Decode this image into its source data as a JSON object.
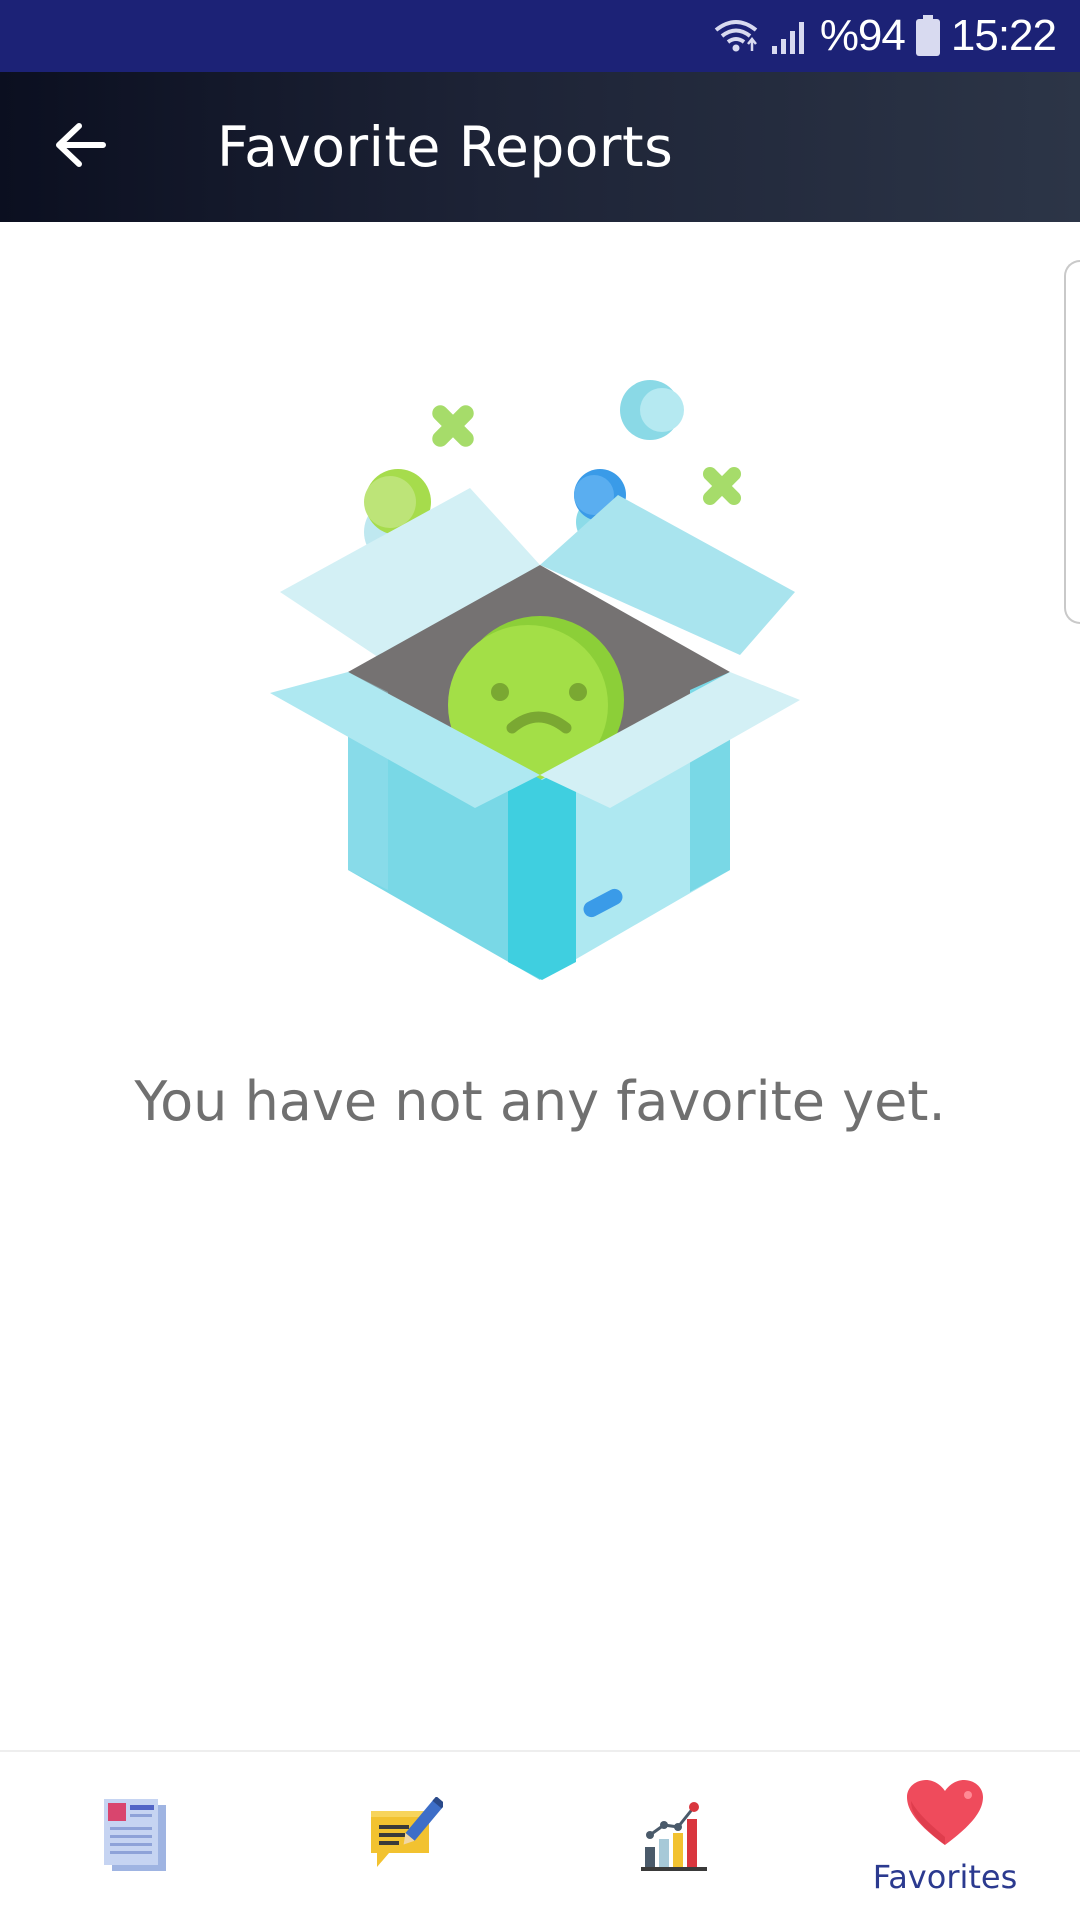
{
  "status_bar": {
    "battery": "%94",
    "time": "15:22",
    "icons": [
      "wifi-icon",
      "signal-icon",
      "battery-icon"
    ]
  },
  "app_bar": {
    "title": "Favorite Reports",
    "back_icon": "arrow-left-icon"
  },
  "empty_state": {
    "illustration": "open-box-sad-face",
    "message": "You have not any favorite yet."
  },
  "bottom_nav": {
    "items": [
      {
        "icon": "newspaper-icon",
        "label": ""
      },
      {
        "icon": "chat-note-icon",
        "label": ""
      },
      {
        "icon": "bar-chart-icon",
        "label": ""
      },
      {
        "icon": "heart-icon",
        "label": "Favorites",
        "active": true
      }
    ],
    "active_color": "#2b3a8f"
  },
  "colors": {
    "status_bar": "#1c2276",
    "app_bar_start": "#0b0f20",
    "app_bar_end": "#2c3547",
    "message_text": "#707070"
  }
}
